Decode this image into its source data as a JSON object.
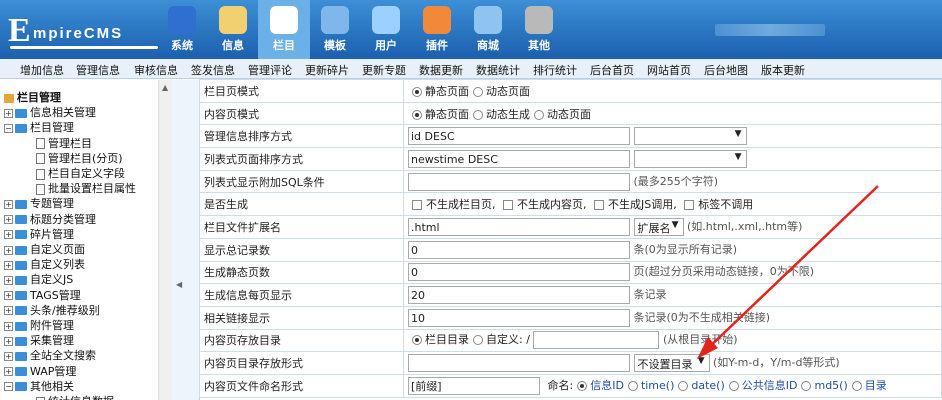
{
  "logo": {
    "big": "E",
    "small": "mpireCMS"
  },
  "nav": [
    {
      "label": "系统",
      "icon": "globe-icon",
      "color": "#2f6fcf"
    },
    {
      "label": "信息",
      "icon": "document-edit-icon",
      "color": "#f0d070"
    },
    {
      "label": "栏目",
      "icon": "folder-icon",
      "color": "#ffffff",
      "active": true
    },
    {
      "label": "模板",
      "icon": "template-window-icon",
      "color": "#7fb7ea"
    },
    {
      "label": "用户",
      "icon": "user-icon",
      "color": "#9bd0ff"
    },
    {
      "label": "插件",
      "icon": "plugin-tools-icon",
      "color": "#f08a3a"
    },
    {
      "label": "商城",
      "icon": "shop-card-icon",
      "color": "#8fc3f0"
    },
    {
      "label": "其他",
      "icon": "gear-icon",
      "color": "#b9b9b9"
    }
  ],
  "menu": [
    "增加信息",
    "管理信息",
    "审核信息",
    "签发信息",
    "管理评论",
    "更新碎片",
    "更新专题",
    "数据更新",
    "数据统计",
    "排行统计",
    "后台首页",
    "网站首页",
    "后台地图",
    "版本更新"
  ],
  "tree": [
    {
      "type": "root",
      "label": "栏目管理"
    },
    {
      "type": "plus",
      "label": "信息相关管理"
    },
    {
      "type": "minus",
      "label": "栏目管理"
    },
    {
      "type": "leaf",
      "label": "管理栏目"
    },
    {
      "type": "leaf",
      "label": "管理栏目(分页)"
    },
    {
      "type": "leaf",
      "label": "栏目自定义字段"
    },
    {
      "type": "leaf",
      "label": "批量设置栏目属性"
    },
    {
      "type": "plus",
      "label": "专题管理"
    },
    {
      "type": "plus",
      "label": "标题分类管理"
    },
    {
      "type": "plus",
      "label": "碎片管理"
    },
    {
      "type": "plus",
      "label": "自定义页面"
    },
    {
      "type": "plus",
      "label": "自定义列表"
    },
    {
      "type": "plus",
      "label": "自定义JS"
    },
    {
      "type": "plus",
      "label": "TAGS管理"
    },
    {
      "type": "plus",
      "label": "头条/推荐级别"
    },
    {
      "type": "plus",
      "label": "附件管理"
    },
    {
      "type": "plus",
      "label": "采集管理"
    },
    {
      "type": "plus",
      "label": "全站全文搜索"
    },
    {
      "type": "plus",
      "label": "WAP管理"
    },
    {
      "type": "minus",
      "label": "其他相关"
    },
    {
      "type": "leaf",
      "label": "统计信息数据"
    }
  ],
  "rows": {
    "r1": {
      "label": "栏目页模式",
      "opt1": "静态页面",
      "opt2": "动态页面"
    },
    "r2": {
      "label": "内容页模式",
      "opt1": "静态页面",
      "opt2": "动态生成",
      "opt3": "动态页面"
    },
    "r3": {
      "label": "管理信息排序方式",
      "value": "id DESC"
    },
    "r4": {
      "label": "列表式页面排序方式",
      "value": "newstime DESC"
    },
    "r5": {
      "label": "列表式显示附加SQL条件",
      "hint": "(最多255个字符)"
    },
    "r6": {
      "label": "是否生成",
      "c1": "不生成栏目页,",
      "c2": "不生成内容页,",
      "c3": "不生成JS调用,",
      "c4": "标签不调用"
    },
    "r7": {
      "label": "栏目文件扩展名",
      "value": ".html",
      "select": "扩展名",
      "hint": "(如.html,.xml,.htm等)"
    },
    "r8": {
      "label": "显示总记录数",
      "value": "0",
      "hint": "条(0为显示所有记录)"
    },
    "r9": {
      "label": "生成静态页数",
      "value": "0",
      "hint": "页(超过分页采用动态链接，0为不限)"
    },
    "r10": {
      "label": "生成信息每页显示",
      "value": "20",
      "hint": "条记录"
    },
    "r11": {
      "label": "相关链接显示",
      "value": "10",
      "hint": "条记录(0为不生成相关链接)"
    },
    "r12": {
      "label": "内容页存放目录",
      "opt1": "栏目目录",
      "opt2": "自定义:",
      "slash": "/",
      "hint": "(从根目录开始)"
    },
    "r13": {
      "label": "内容页目录存放形式",
      "select": "不设置目录",
      "hint": "(如Y-m-d，Y/m-d等形式)"
    },
    "r14": {
      "label": "内容页文件命名形式",
      "prefix": "[前缀]",
      "namelabel": "命名:",
      "n1": "信息ID",
      "n2": "time()",
      "n3": "date()",
      "n4": "公共信息ID",
      "n5": "md5()",
      "n6": "目录"
    }
  },
  "colors": {
    "accent": "#1b5fae",
    "arrow": "#e3241b"
  }
}
